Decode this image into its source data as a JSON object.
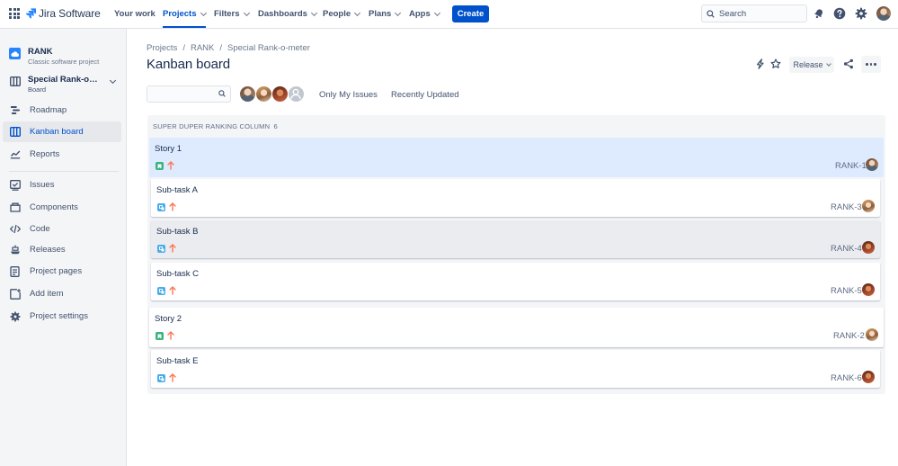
{
  "topnav": {
    "product": "Jira Software",
    "items": [
      {
        "label": "Your work",
        "dropdown": false
      },
      {
        "label": "Projects",
        "dropdown": true,
        "active": true
      },
      {
        "label": "Filters",
        "dropdown": true
      },
      {
        "label": "Dashboards",
        "dropdown": true
      },
      {
        "label": "People",
        "dropdown": true
      },
      {
        "label": "Plans",
        "dropdown": true
      },
      {
        "label": "Apps",
        "dropdown": true
      }
    ],
    "create_label": "Create",
    "search_placeholder": "Search",
    "icons": [
      "notifications-icon",
      "help-icon",
      "settings-icon",
      "profile-avatar"
    ]
  },
  "sidebar": {
    "project": {
      "name": "RANK",
      "type": "Classic software project"
    },
    "board": {
      "name": "Special Rank-o-meter",
      "sub": "Board"
    },
    "items": [
      {
        "label": "Roadmap",
        "icon": "roadmap-icon"
      },
      {
        "label": "Kanban board",
        "icon": "board-icon",
        "active": true
      },
      {
        "label": "Reports",
        "icon": "reports-icon"
      },
      {
        "label": "Issues",
        "icon": "issues-icon"
      },
      {
        "label": "Components",
        "icon": "components-icon"
      },
      {
        "label": "Code",
        "icon": "code-icon"
      },
      {
        "label": "Releases",
        "icon": "releases-icon"
      },
      {
        "label": "Project pages",
        "icon": "pages-icon"
      },
      {
        "label": "Add item",
        "icon": "add-item-icon"
      },
      {
        "label": "Project settings",
        "icon": "settings-icon"
      }
    ]
  },
  "main": {
    "breadcrumb": [
      "Projects",
      "RANK",
      "Special Rank-o-meter"
    ],
    "title": "Kanban board",
    "release_label": "Release",
    "quick_filters": [
      "Only My Issues",
      "Recently Updated"
    ]
  },
  "column": {
    "title": "SUPER DUPER RANKING COLUMN",
    "count": "6"
  },
  "cards": [
    {
      "title": "Story 1",
      "key": "RANK-1",
      "kind": "story",
      "state": "selected",
      "avatar": "av-a"
    },
    {
      "title": "Sub-task A",
      "key": "RANK-3",
      "kind": "subtask",
      "avatar": "av-b"
    },
    {
      "title": "Sub-task B",
      "key": "RANK-4",
      "kind": "subtask",
      "state": "hover",
      "avatar": "av-c"
    },
    {
      "title": "Sub-task C",
      "key": "RANK-5",
      "kind": "subtask",
      "avatar": "av-c"
    },
    {
      "title": "Story 2",
      "key": "RANK-2",
      "kind": "story",
      "avatar": "av-b"
    },
    {
      "title": "Sub-task E",
      "key": "RANK-6",
      "kind": "subtask",
      "avatar": "av-c"
    }
  ],
  "colors": {
    "brand": "#0052cc",
    "story": "#36b37e",
    "subtask": "#4bade8",
    "priority_medium": "#ff7452",
    "selected_card": "#deebff"
  }
}
